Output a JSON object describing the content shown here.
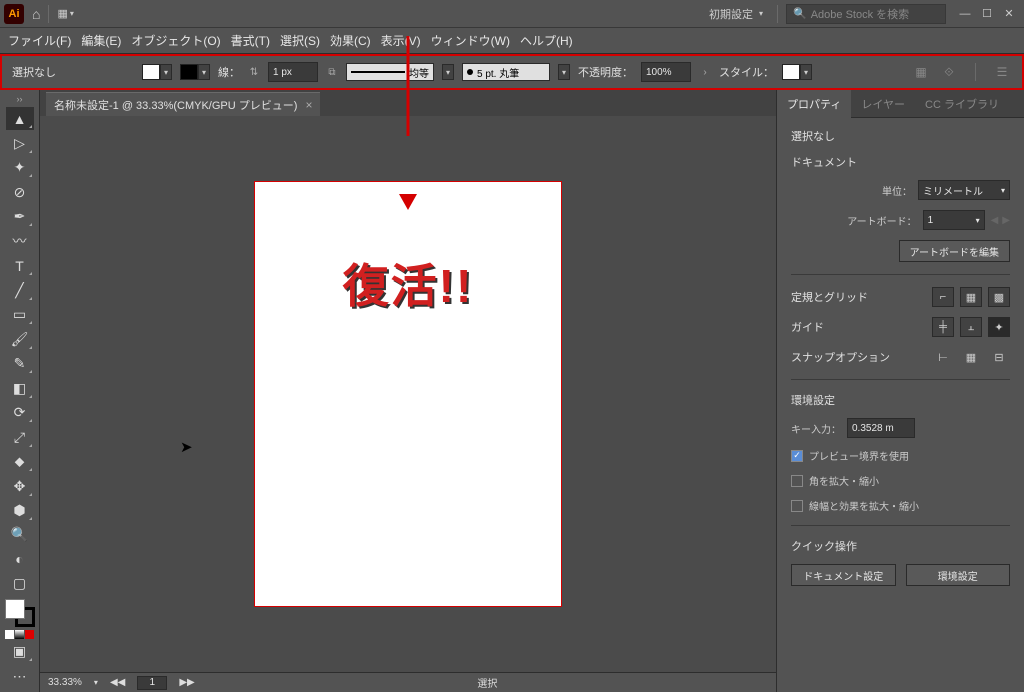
{
  "titlebar": {
    "workspace": "初期設定",
    "search_placeholder": "Adobe Stock を検索"
  },
  "menu": {
    "file": "ファイル(F)",
    "edit": "編集(E)",
    "object": "オブジェクト(O)",
    "type": "書式(T)",
    "select": "選択(S)",
    "effect": "効果(C)",
    "view": "表示(V)",
    "window": "ウィンドウ(W)",
    "help": "ヘルプ(H)"
  },
  "control": {
    "selection": "選択なし",
    "stroke_label": "線：",
    "stroke_width": "1 px",
    "profile": "均等",
    "brush": "5 pt. 丸筆",
    "opacity_label": "不透明度：",
    "opacity": "100%",
    "style_label": "スタイル："
  },
  "doc_tab": {
    "name": "名称未設定-1 @ 33.33%(CMYK/GPU プレビュー)"
  },
  "annotation": "復活!!",
  "status": {
    "zoom": "33.33%",
    "artboard_num": "1",
    "tool": "選択"
  },
  "panel": {
    "tab_prop": "プロパティ",
    "tab_layer": "レイヤー",
    "tab_cc": "CC ライブラリ",
    "selection": "選択なし",
    "doc_title": "ドキュメント",
    "units_label": "単位：",
    "units": "ミリメートル",
    "artboard_label": "アートボード：",
    "artboard": "1",
    "edit_artboard": "アートボードを編集",
    "ruler_grid": "定規とグリッド",
    "guide": "ガイド",
    "snap": "スナップオプション",
    "prefs_title": "環境設定",
    "key_label": "キー入力：",
    "key_value": "0.3528 m",
    "use_preview": "プレビュー境界を使用",
    "scale_corner": "角を拡大・縮小",
    "scale_stroke": "線幅と効果を拡大・縮小",
    "quick_title": "クイック操作",
    "btn_docsetup": "ドキュメント設定",
    "btn_pref": "環境設定"
  }
}
